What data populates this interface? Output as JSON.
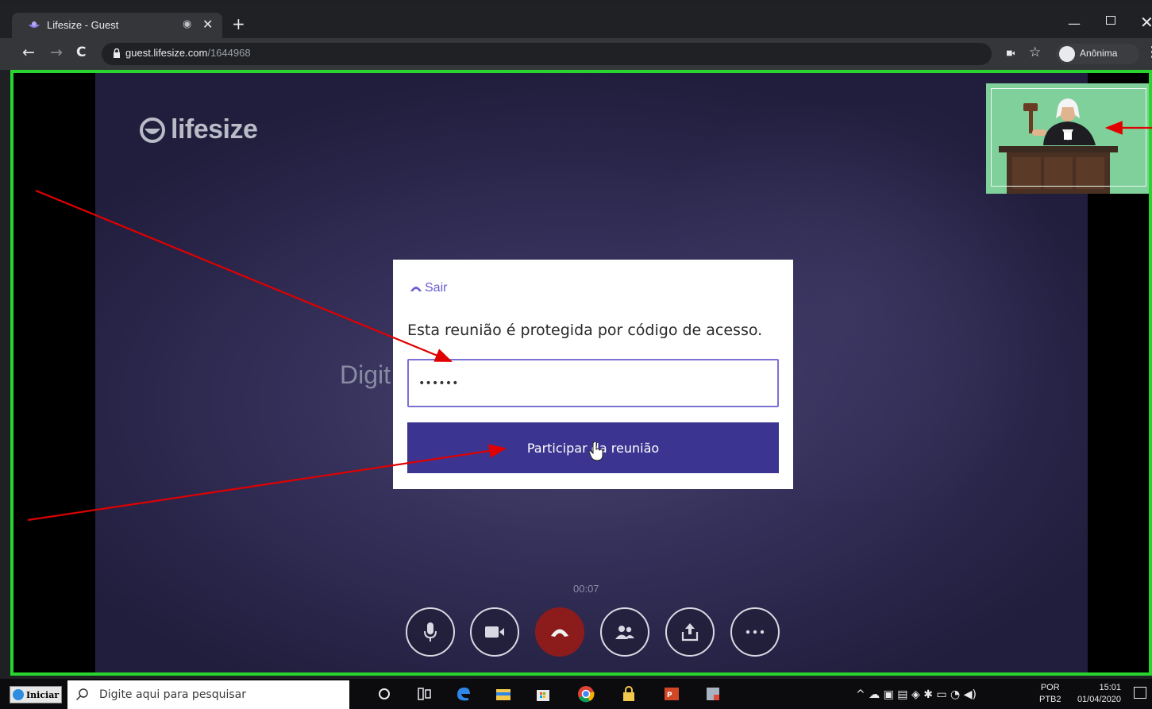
{
  "browser": {
    "tab_title": "Lifesize - Guest",
    "url_host": "guest.lifesize.com",
    "url_path": "/1644968",
    "incognito_label": "Anônima"
  },
  "app": {
    "logo_text": "lifesize",
    "background_text": "Digit",
    "timer": "00:07"
  },
  "dialog": {
    "exit_label": "Sair",
    "message": "Esta reunião é protegida por código de acesso.",
    "input_value": "••••••",
    "join_label": "Participar da reunião"
  },
  "controls": [
    "microphone",
    "camera",
    "hang-up",
    "participants",
    "share",
    "more"
  ],
  "taskbar": {
    "start_label": "Iniciar",
    "search_placeholder": "Digite aqui para pesquisar",
    "lang_top": "POR",
    "lang_bottom": "PTB2",
    "time": "15:01",
    "date": "01/04/2020"
  },
  "colors": {
    "highlight_border": "#28d42e",
    "annotation_arrow": "#e00000",
    "join_button": "#3b3591",
    "accent": "#6a5ed0",
    "hangup": "#8c1c1c"
  }
}
